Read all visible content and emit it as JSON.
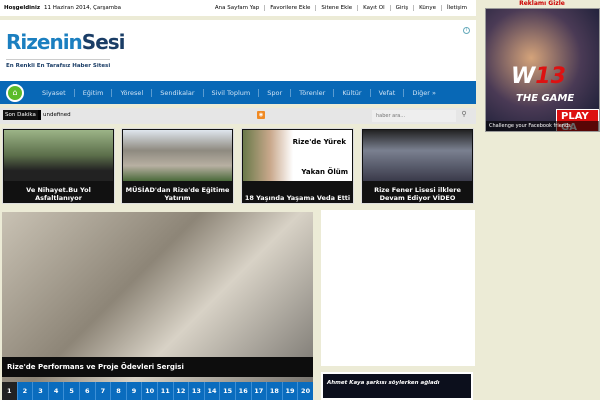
{
  "topbar": {
    "welcome": "Hoşgeldiniz",
    "date": "11 Haziran 2014, Çarşamba",
    "links": [
      "Ana Sayfam Yap",
      "Favorilere Ekle",
      "Sitene Ekle",
      "Kayıt Ol",
      "Giriş",
      "Künye",
      "İletişim"
    ]
  },
  "header": {
    "logo_a": "Rizenin",
    "logo_b": "Sesi",
    "slogan": "En Renkli En Tarafsız Haber Sitesi",
    "ad_info": "i"
  },
  "nav": {
    "items": [
      "Siyaset",
      "Eğitim",
      "Yöresel",
      "Sendikalar",
      "Sivil Toplum",
      "Spor",
      "Törenler",
      "Kültür",
      "Vefat",
      "Diğer »"
    ]
  },
  "ticker": {
    "label": "Son Dakika",
    "text": "undefined",
    "search_placeholder": "haber ara..."
  },
  "thumbs": [
    {
      "title": "Ve Nihayet.Bu Yol Asfaltlanıyor"
    },
    {
      "title": "MÜSİAD'dan Rize'de Eğitime Yatırım"
    },
    {
      "title": "18 Yaşında Yaşama Veda Etti",
      "overlay": [
        "Rize'de Yürek",
        "Yakan Ölüm"
      ]
    },
    {
      "title": "Rize Fener Lisesi ilklere Devam Ediyor VİDEO"
    }
  ],
  "slider": {
    "caption": "Rize'de Performans ve Proje Ödevleri Sergisi",
    "pages": [
      "1",
      "2",
      "3",
      "4",
      "5",
      "6",
      "7",
      "8",
      "9",
      "10",
      "11",
      "12",
      "13",
      "14",
      "15",
      "16",
      "17",
      "18",
      "19",
      "20"
    ],
    "active": "1"
  },
  "side": {
    "video_caption": "Ahmet Kaya şarkısı söylerken ağladı"
  },
  "ad": {
    "hide": "Reklamı Gizle",
    "w": "W",
    "num": "13",
    "game": "THE GAME",
    "play": "PLAY GA",
    "fb": "Challenge your Facebook friends"
  }
}
